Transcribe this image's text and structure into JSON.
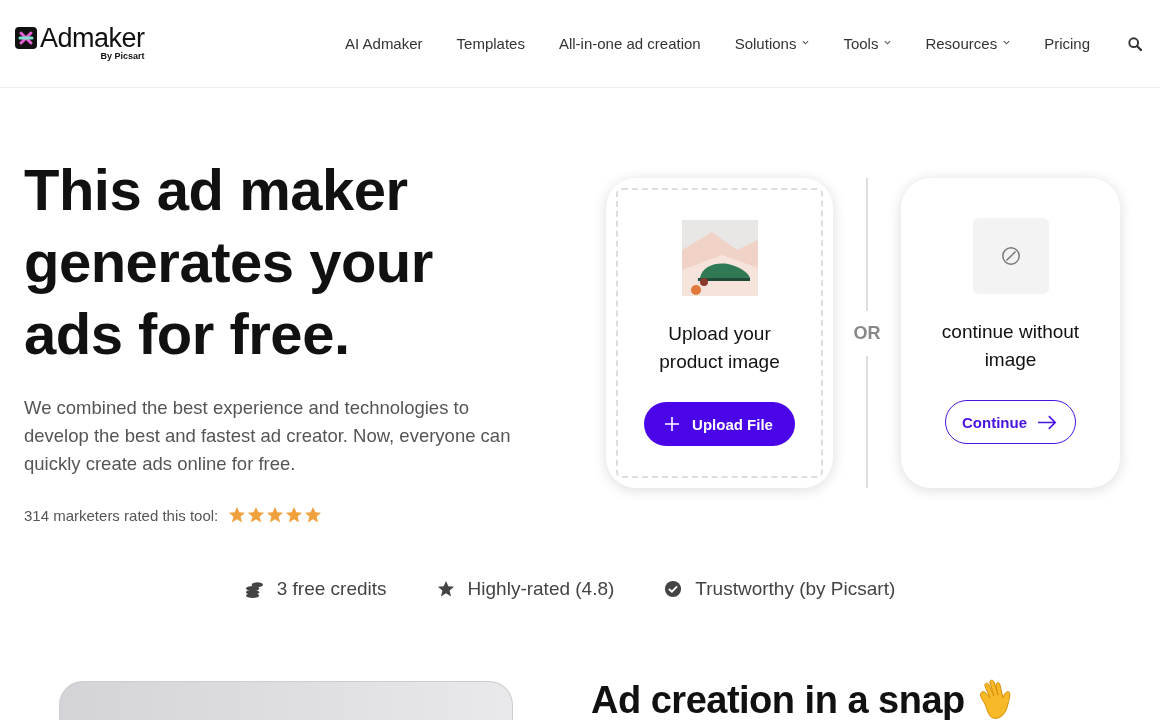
{
  "logo": {
    "name": "Admaker",
    "byline": "By Picsart"
  },
  "nav": [
    {
      "label": "AI Admaker",
      "dropdown": false
    },
    {
      "label": "Templates",
      "dropdown": false
    },
    {
      "label": "All-in-one ad creation",
      "dropdown": false
    },
    {
      "label": "Solutions",
      "dropdown": true
    },
    {
      "label": "Tools",
      "dropdown": true
    },
    {
      "label": "Resources",
      "dropdown": true
    },
    {
      "label": "Pricing",
      "dropdown": false
    }
  ],
  "hero": {
    "title": "This ad maker generates your ads for free.",
    "description": "We combined the best experience and technologies to develop the best and fastest ad creator. Now, everyone can quickly create ads online for free.",
    "rating_label": "314 marketers rated this tool:",
    "stars": 5
  },
  "upload_card": {
    "title": "Upload your product image",
    "button": "Upload File"
  },
  "divider_label": "OR",
  "continue_card": {
    "title": "continue without image",
    "button": "Continue"
  },
  "features": [
    {
      "kind": "coins",
      "label": "3 free credits"
    },
    {
      "kind": "star",
      "label": "Highly-rated (4.8)"
    },
    {
      "kind": "check",
      "label": "Trustworthy (by Picsart)"
    }
  ],
  "section": {
    "title": "Ad creation in a snap"
  }
}
